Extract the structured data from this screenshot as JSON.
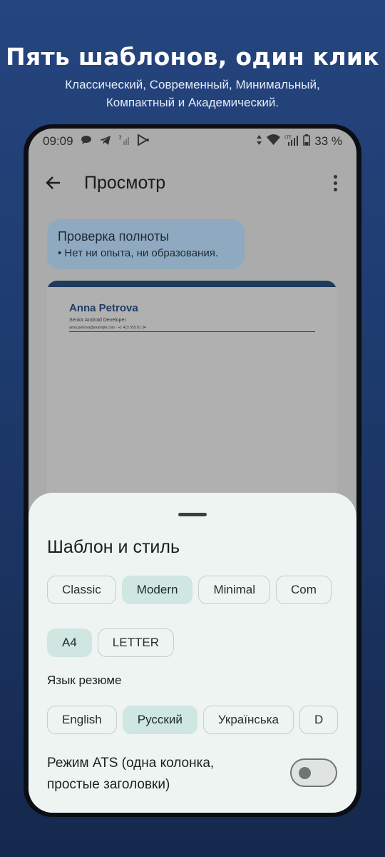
{
  "promo": {
    "title": "Пять шаблонов, один клик",
    "subtitle_line1": "Классический, Современный, Минимальный,",
    "subtitle_line2": "Компактный и Академический."
  },
  "status_bar": {
    "time": "09:09",
    "battery": "33 %",
    "network": "LTE",
    "icons": [
      "chat-icon",
      "telegram-icon",
      "signal-unknown-icon",
      "play-store-icon",
      "data-arrows-icon",
      "wifi-icon",
      "lte-signal-icon",
      "battery-icon"
    ]
  },
  "app_bar": {
    "title": "Просмотр",
    "back_icon": "arrow-back-icon",
    "more_icon": "more-vert-icon"
  },
  "completeness": {
    "title": "Проверка полноты",
    "item": "• Нет ни опыта, ни образования."
  },
  "resume_preview": {
    "name": "Anna Petrova",
    "role": "Senior Android Developer",
    "contact": "anna.petrova@example.com   ·   +1 415 555 01 34",
    "accent": "#1e3a5d"
  },
  "sheet": {
    "title": "Шаблон и стиль",
    "templates": [
      {
        "label": "Classic",
        "selected": false
      },
      {
        "label": "Modern",
        "selected": true
      },
      {
        "label": "Minimal",
        "selected": false
      },
      {
        "label": "Com",
        "selected": false
      }
    ],
    "paper_sizes": [
      {
        "label": "A4",
        "selected": true
      },
      {
        "label": "LETTER",
        "selected": false
      }
    ],
    "language_label": "Язык резюме",
    "languages": [
      {
        "label": "English",
        "selected": false
      },
      {
        "label": "Русский",
        "selected": true
      },
      {
        "label": "Українська",
        "selected": false
      },
      {
        "label": "D",
        "selected": false
      }
    ],
    "ats_label": "Режим ATS (одна колонка, простые заголовки)",
    "ats_enabled": false
  },
  "colors": {
    "selected_chip": "#cfe6e1",
    "sheet_bg": "#eef4f2",
    "background_top": "#25457f",
    "background_bottom": "#15284d"
  }
}
